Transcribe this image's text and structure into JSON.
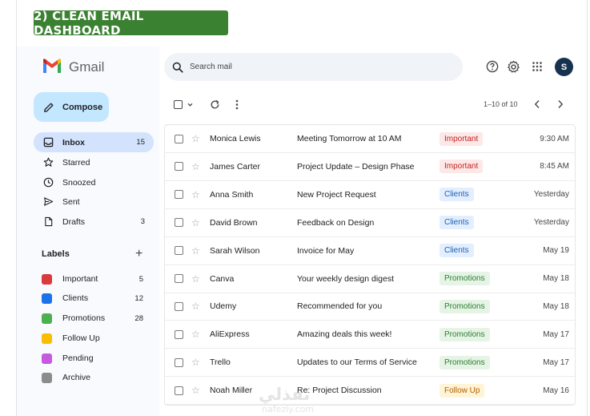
{
  "banner": {
    "title": "2) CLEAN EMAIL DASHBOARD"
  },
  "app": {
    "name": "Gmail",
    "avatar_letter": "S"
  },
  "colors": {
    "compose_bg": "#c2e7ff",
    "active_nav_bg": "#d3e3fd",
    "banner_bg": "#3b8132",
    "label_important": "#d93a3a",
    "label_clients": "#1a73e8",
    "label_promotions": "#4caf50",
    "label_followup": "#fbbc04",
    "label_pending": "#c55ae0",
    "label_archive": "#8c8c8c"
  },
  "compose": {
    "label": "Compose",
    "icon": "pencil-icon"
  },
  "nav": [
    {
      "label": "Inbox",
      "count": "15",
      "icon": "inbox-icon",
      "active": true
    },
    {
      "label": "Starred",
      "count": "",
      "icon": "star-icon"
    },
    {
      "label": "Snoozed",
      "count": "",
      "icon": "clock-icon"
    },
    {
      "label": "Sent",
      "count": "",
      "icon": "send-icon"
    },
    {
      "label": "Drafts",
      "count": "3",
      "icon": "draft-icon"
    }
  ],
  "labels": {
    "heading": "Labels",
    "add": "+",
    "items": [
      {
        "name": "Important",
        "count": "5",
        "color": "#d93a3a"
      },
      {
        "name": "Clients",
        "count": "12",
        "color": "#1a73e8"
      },
      {
        "name": "Promotions",
        "count": "28",
        "color": "#4caf50"
      },
      {
        "name": "Follow Up",
        "count": "",
        "color": "#fbbc04"
      },
      {
        "name": "Pending",
        "count": "",
        "color": "#c55ae0"
      },
      {
        "name": "Archive",
        "count": "",
        "color": "#8c8c8c"
      }
    ]
  },
  "search": {
    "placeholder": "Search mail"
  },
  "toolbar": {
    "pager": "1–10 of 10"
  },
  "emails": [
    {
      "sender": "Monica Lewis",
      "subject": "Meeting Tomorrow at 10 AM",
      "tag": "Important",
      "time": "9:30 AM"
    },
    {
      "sender": "James Carter",
      "subject": "Project Update – Design Phase",
      "tag": "Important",
      "time": "8:45 AM"
    },
    {
      "sender": "Anna Smith",
      "subject": "New Project Request",
      "tag": "Clients",
      "time": "Yesterday"
    },
    {
      "sender": "David Brown",
      "subject": "Feedback on Design",
      "tag": "Clients",
      "time": "Yesterday"
    },
    {
      "sender": "Sarah Wilson",
      "subject": "Invoice for May",
      "tag": "Clients",
      "time": "May 19"
    },
    {
      "sender": "Canva",
      "subject": "Your weekly design digest",
      "tag": "Promotions",
      "time": "May 18"
    },
    {
      "sender": "Udemy",
      "subject": "Recommended for you",
      "tag": "Promotions",
      "time": "May 18"
    },
    {
      "sender": "AliExpress",
      "subject": "Amazing deals this week!",
      "tag": "Promotions",
      "time": "May 17"
    },
    {
      "sender": "Trello",
      "subject": "Updates to our Terms of Service",
      "tag": "Promotions",
      "time": "May 17"
    },
    {
      "sender": "Noah Miller",
      "subject": "Re: Project Discussion",
      "tag": "Follow Up",
      "time": "May 16"
    }
  ],
  "tag_styles": {
    "Important": {
      "bg": "#fde8e8",
      "fg": "#c5221f"
    },
    "Clients": {
      "bg": "#e3efff",
      "fg": "#1a5fb4"
    },
    "Promotions": {
      "bg": "#e6f4e6",
      "fg": "#2e7d32"
    },
    "Follow Up": {
      "bg": "#fff4d6",
      "fg": "#b06000"
    }
  },
  "watermark": {
    "arabic": "نفذلي",
    "latin": "nafezly.com"
  }
}
